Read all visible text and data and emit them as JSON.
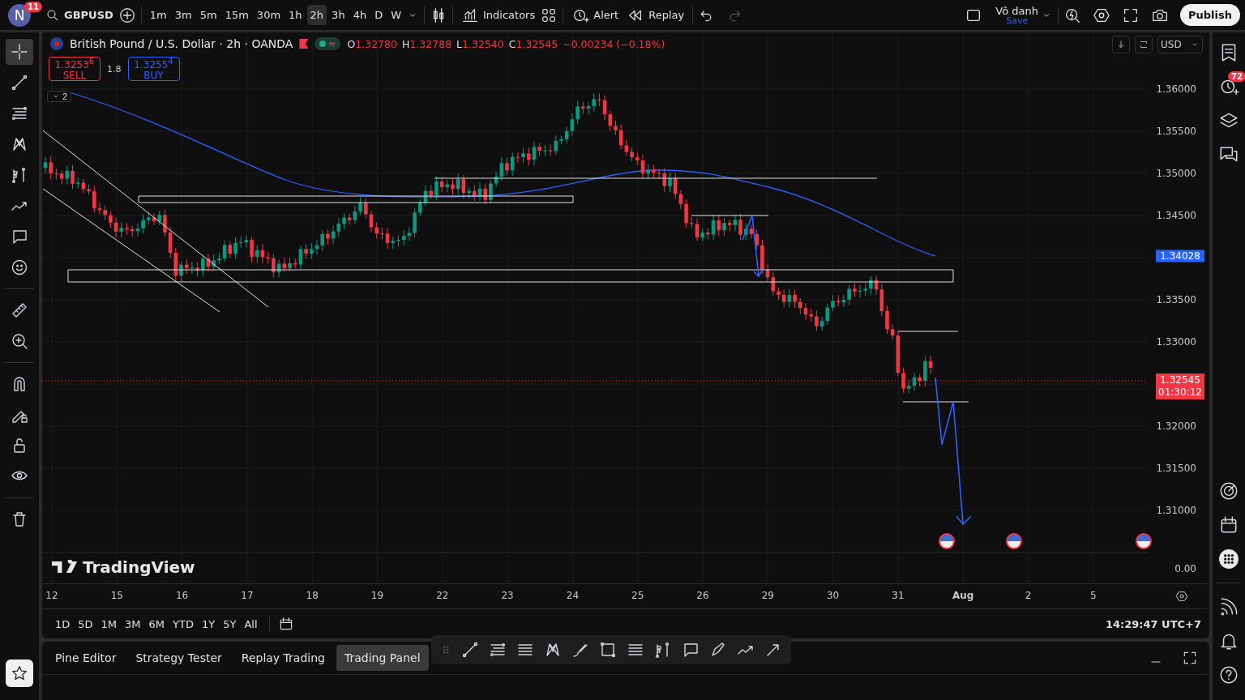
{
  "top_bar": {
    "user_initial": "N",
    "notification_count": "11",
    "symbol": "GBPUSD",
    "intervals": [
      {
        "label": "1m",
        "selected": false
      },
      {
        "label": "3m",
        "selected": false
      },
      {
        "label": "5m",
        "selected": false
      },
      {
        "label": "15m",
        "selected": false
      },
      {
        "label": "30m",
        "selected": false
      },
      {
        "label": "1h",
        "selected": false
      },
      {
        "label": "2h",
        "selected": true
      },
      {
        "label": "3h",
        "selected": false
      },
      {
        "label": "4h",
        "selected": false
      },
      {
        "label": "D",
        "selected": false
      },
      {
        "label": "W",
        "selected": false
      }
    ],
    "indicators_label": "Indicators",
    "alert_label": "Alert",
    "replay_label": "Replay",
    "layout_name": "Vô danh",
    "save_label": "Save",
    "publish_label": "Publish"
  },
  "left_toolbar": [
    {
      "kind": "crosshair",
      "selected": true
    },
    {
      "kind": "trend-line",
      "selected": false
    },
    {
      "kind": "fib",
      "selected": false
    },
    {
      "kind": "pattern",
      "selected": false
    },
    {
      "kind": "forecast",
      "selected": false
    },
    {
      "kind": "path",
      "selected": false
    },
    {
      "kind": "note",
      "selected": false
    },
    {
      "kind": "emoji",
      "selected": false
    },
    {
      "kind": "ruler",
      "selected": false
    },
    {
      "kind": "zoom",
      "selected": false
    },
    {
      "kind": "magnet",
      "selected": false
    },
    {
      "kind": "pencil-lock",
      "selected": false
    },
    {
      "kind": "lock",
      "selected": false
    },
    {
      "kind": "eye",
      "selected": false
    },
    {
      "kind": "trash",
      "selected": false
    }
  ],
  "chart": {
    "legend": {
      "title": "British Pound / U.S. Dollar · 2h · OANDA",
      "ohlc": [
        {
          "label": "O",
          "value": "1.32780"
        },
        {
          "label": "H",
          "value": "1.32788"
        },
        {
          "label": "L",
          "value": "1.32540"
        },
        {
          "label": "C",
          "value": "1.32545"
        }
      ],
      "change": "−0.00234 (−0.18%)"
    },
    "sell": {
      "price": "1.3253$^{6}$",
      "label": "SELL"
    },
    "spread": "1.8",
    "buy": {
      "price": "1.3255$^{4}$",
      "label": "BUY"
    },
    "indicators_collapsed": "2",
    "currency": "USD",
    "price_ticks": [
      "1.36000",
      "1.35500",
      "1.35000",
      "1.34500",
      "1.33500",
      "1.33000",
      "1.32000",
      "1.31500",
      "1.31000"
    ],
    "market_status_symbol": "≈",
    "ma_price": "1.34028",
    "last_price": "1.32545",
    "countdown": "01:30:12",
    "volume_tick": "0.00",
    "logo_text": "TradingView",
    "time_ticks": [
      {
        "label": "12",
        "kind": "day"
      },
      {
        "label": "15",
        "kind": "day"
      },
      {
        "label": "16",
        "kind": "day"
      },
      {
        "label": "17",
        "kind": "day"
      },
      {
        "label": "18",
        "kind": "day"
      },
      {
        "label": "19",
        "kind": "day"
      },
      {
        "label": "22",
        "kind": "day"
      },
      {
        "label": "23",
        "kind": "day"
      },
      {
        "label": "24",
        "kind": "day"
      },
      {
        "label": "25",
        "kind": "day"
      },
      {
        "label": "26",
        "kind": "day"
      },
      {
        "label": "29",
        "kind": "day"
      },
      {
        "label": "30",
        "kind": "day"
      },
      {
        "label": "31",
        "kind": "day"
      },
      {
        "label": "Aug",
        "kind": "month"
      },
      {
        "label": "2",
        "kind": "day"
      },
      {
        "label": "5",
        "kind": "day"
      }
    ],
    "ranges": [
      "1D",
      "5D",
      "1M",
      "3M",
      "6M",
      "YTD",
      "1Y",
      "5Y",
      "All"
    ],
    "clock": "14:29:47 UTC+7"
  },
  "bottom_panel": {
    "tabs": [
      {
        "label": "Pine Editor",
        "selected": false
      },
      {
        "label": "Strategy Tester",
        "selected": false
      },
      {
        "label": "Replay Trading",
        "selected": false
      },
      {
        "label": "Trading Panel",
        "selected": true
      }
    ]
  },
  "right_sidebar": {
    "alerts_count": "72"
  }
}
